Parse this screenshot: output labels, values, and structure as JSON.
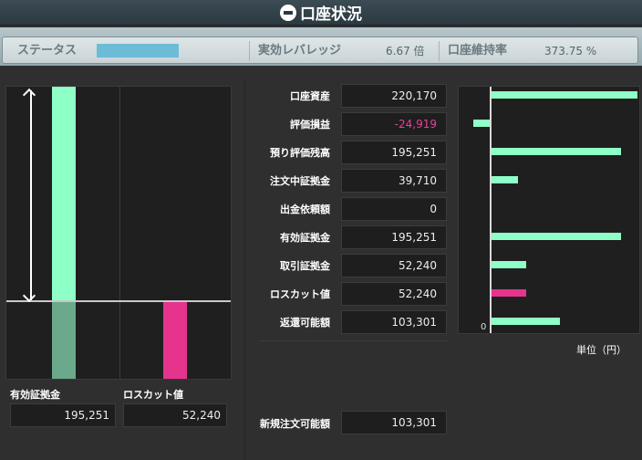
{
  "header": {
    "title": "口座状況",
    "icon": "minus-circle-icon"
  },
  "status": {
    "status_label": "ステータス",
    "leverage_label": "実効レバレッジ",
    "leverage_value": "6.67 倍",
    "margin_rate_label": "口座維持率",
    "margin_rate_value": "373.75 %",
    "status_bar_color": "#6cbcd7"
  },
  "rows": [
    {
      "label": "口座資産",
      "value": "220,170"
    },
    {
      "label": "評価損益",
      "value": "-24,919"
    },
    {
      "label": "預り評価残高",
      "value": "195,251"
    },
    {
      "label": "注文中証拠金",
      "value": "39,710"
    },
    {
      "label": "出金依頼額",
      "value": "0"
    },
    {
      "label": "有効証拠金",
      "value": "195,251"
    },
    {
      "label": "取引証拠金",
      "value": "52,240"
    },
    {
      "label": "ロスカット値",
      "value": "52,240"
    },
    {
      "label": "返還可能額",
      "value": "103,301"
    }
  ],
  "new_order": {
    "label": "新規注文可能額",
    "value": "103,301"
  },
  "left_chart": {
    "effective_margin_label": "有効証拠金",
    "effective_margin_value": "195,251",
    "losscut_label": "ロスカット値",
    "losscut_value": "52,240"
  },
  "right_chart": {
    "zero_label": "0",
    "unit": "単位（円）"
  },
  "chart_data": {
    "type": "bar",
    "categories": [
      "口座資産",
      "評価損益",
      "預り評価残高",
      "注文中証拠金",
      "出金依頼額",
      "有効証拠金",
      "取引証拠金",
      "ロスカット値",
      "返還可能額"
    ],
    "values": [
      220170,
      -24919,
      195251,
      39710,
      0,
      195251,
      52240,
      52240,
      103301
    ],
    "colors": [
      "#8effc6",
      "#8effc6",
      "#8effc6",
      "#8effc6",
      "#8effc6",
      "#8effc6",
      "#8effc6",
      "#e6338e",
      "#8effc6"
    ],
    "xlabel": "",
    "ylabel": "単位（円）"
  },
  "colors": {
    "green": "#8effc6",
    "pink": "#e6338e",
    "dark_green": "#6aa98a"
  }
}
